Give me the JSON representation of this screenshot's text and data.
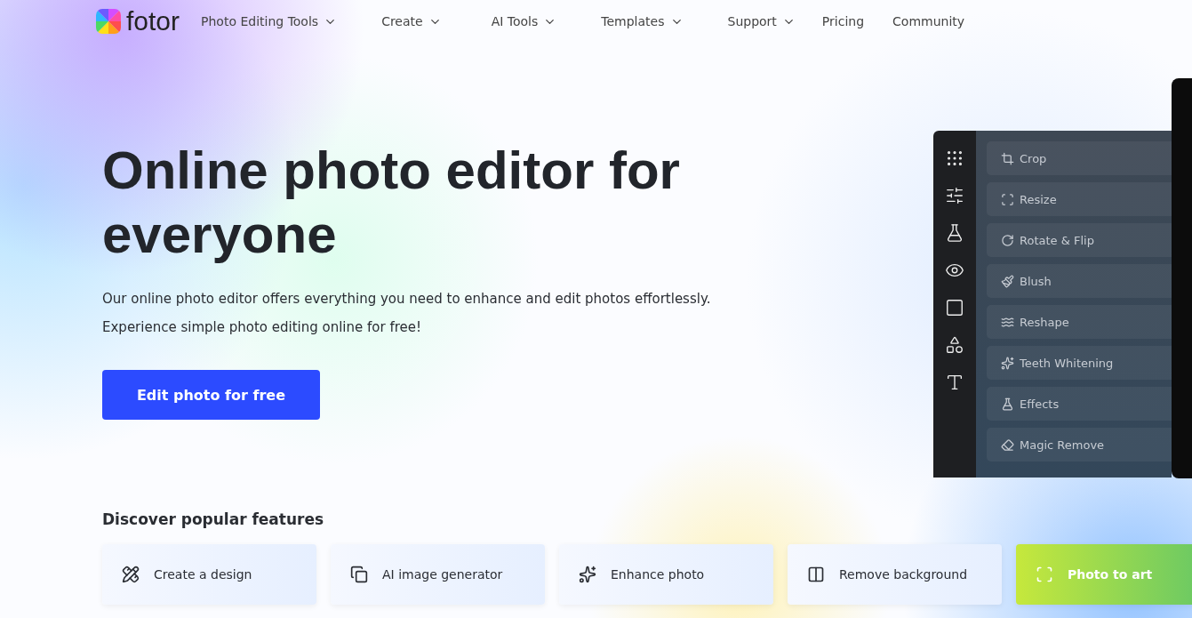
{
  "nav": {
    "brand": "fotor",
    "items": [
      {
        "label": "Photo Editing Tools",
        "dropdown": true
      },
      {
        "label": "Create",
        "dropdown": true
      },
      {
        "label": "AI Tools",
        "dropdown": true
      },
      {
        "label": "Templates",
        "dropdown": true
      },
      {
        "label": "Support",
        "dropdown": true
      },
      {
        "label": "Pricing",
        "dropdown": false
      },
      {
        "label": "Community",
        "dropdown": false
      }
    ]
  },
  "hero": {
    "title": "Online photo editor for everyone",
    "lines": [
      "Our online photo editor offers everything you need to enhance and edit photos effortlessly.",
      "Experience simple photo editing online for free!"
    ],
    "cta": "Edit photo for free"
  },
  "editor": {
    "tools": [
      {
        "label": "Crop"
      },
      {
        "label": "Resize"
      },
      {
        "label": "Rotate & Flip"
      },
      {
        "label": "Blush"
      },
      {
        "label": "Reshape"
      },
      {
        "label": "Teeth Whitening"
      },
      {
        "label": "Effects"
      },
      {
        "label": "Magic Remove"
      }
    ]
  },
  "features": {
    "title": "Discover popular features",
    "items": [
      {
        "label": "Create a design",
        "kind": "plain"
      },
      {
        "label": "AI image generator",
        "kind": "plain"
      },
      {
        "label": "Enhance photo",
        "kind": "plain"
      },
      {
        "label": "Remove background",
        "kind": "plain"
      },
      {
        "label": "Photo to art",
        "kind": "promo"
      }
    ]
  }
}
